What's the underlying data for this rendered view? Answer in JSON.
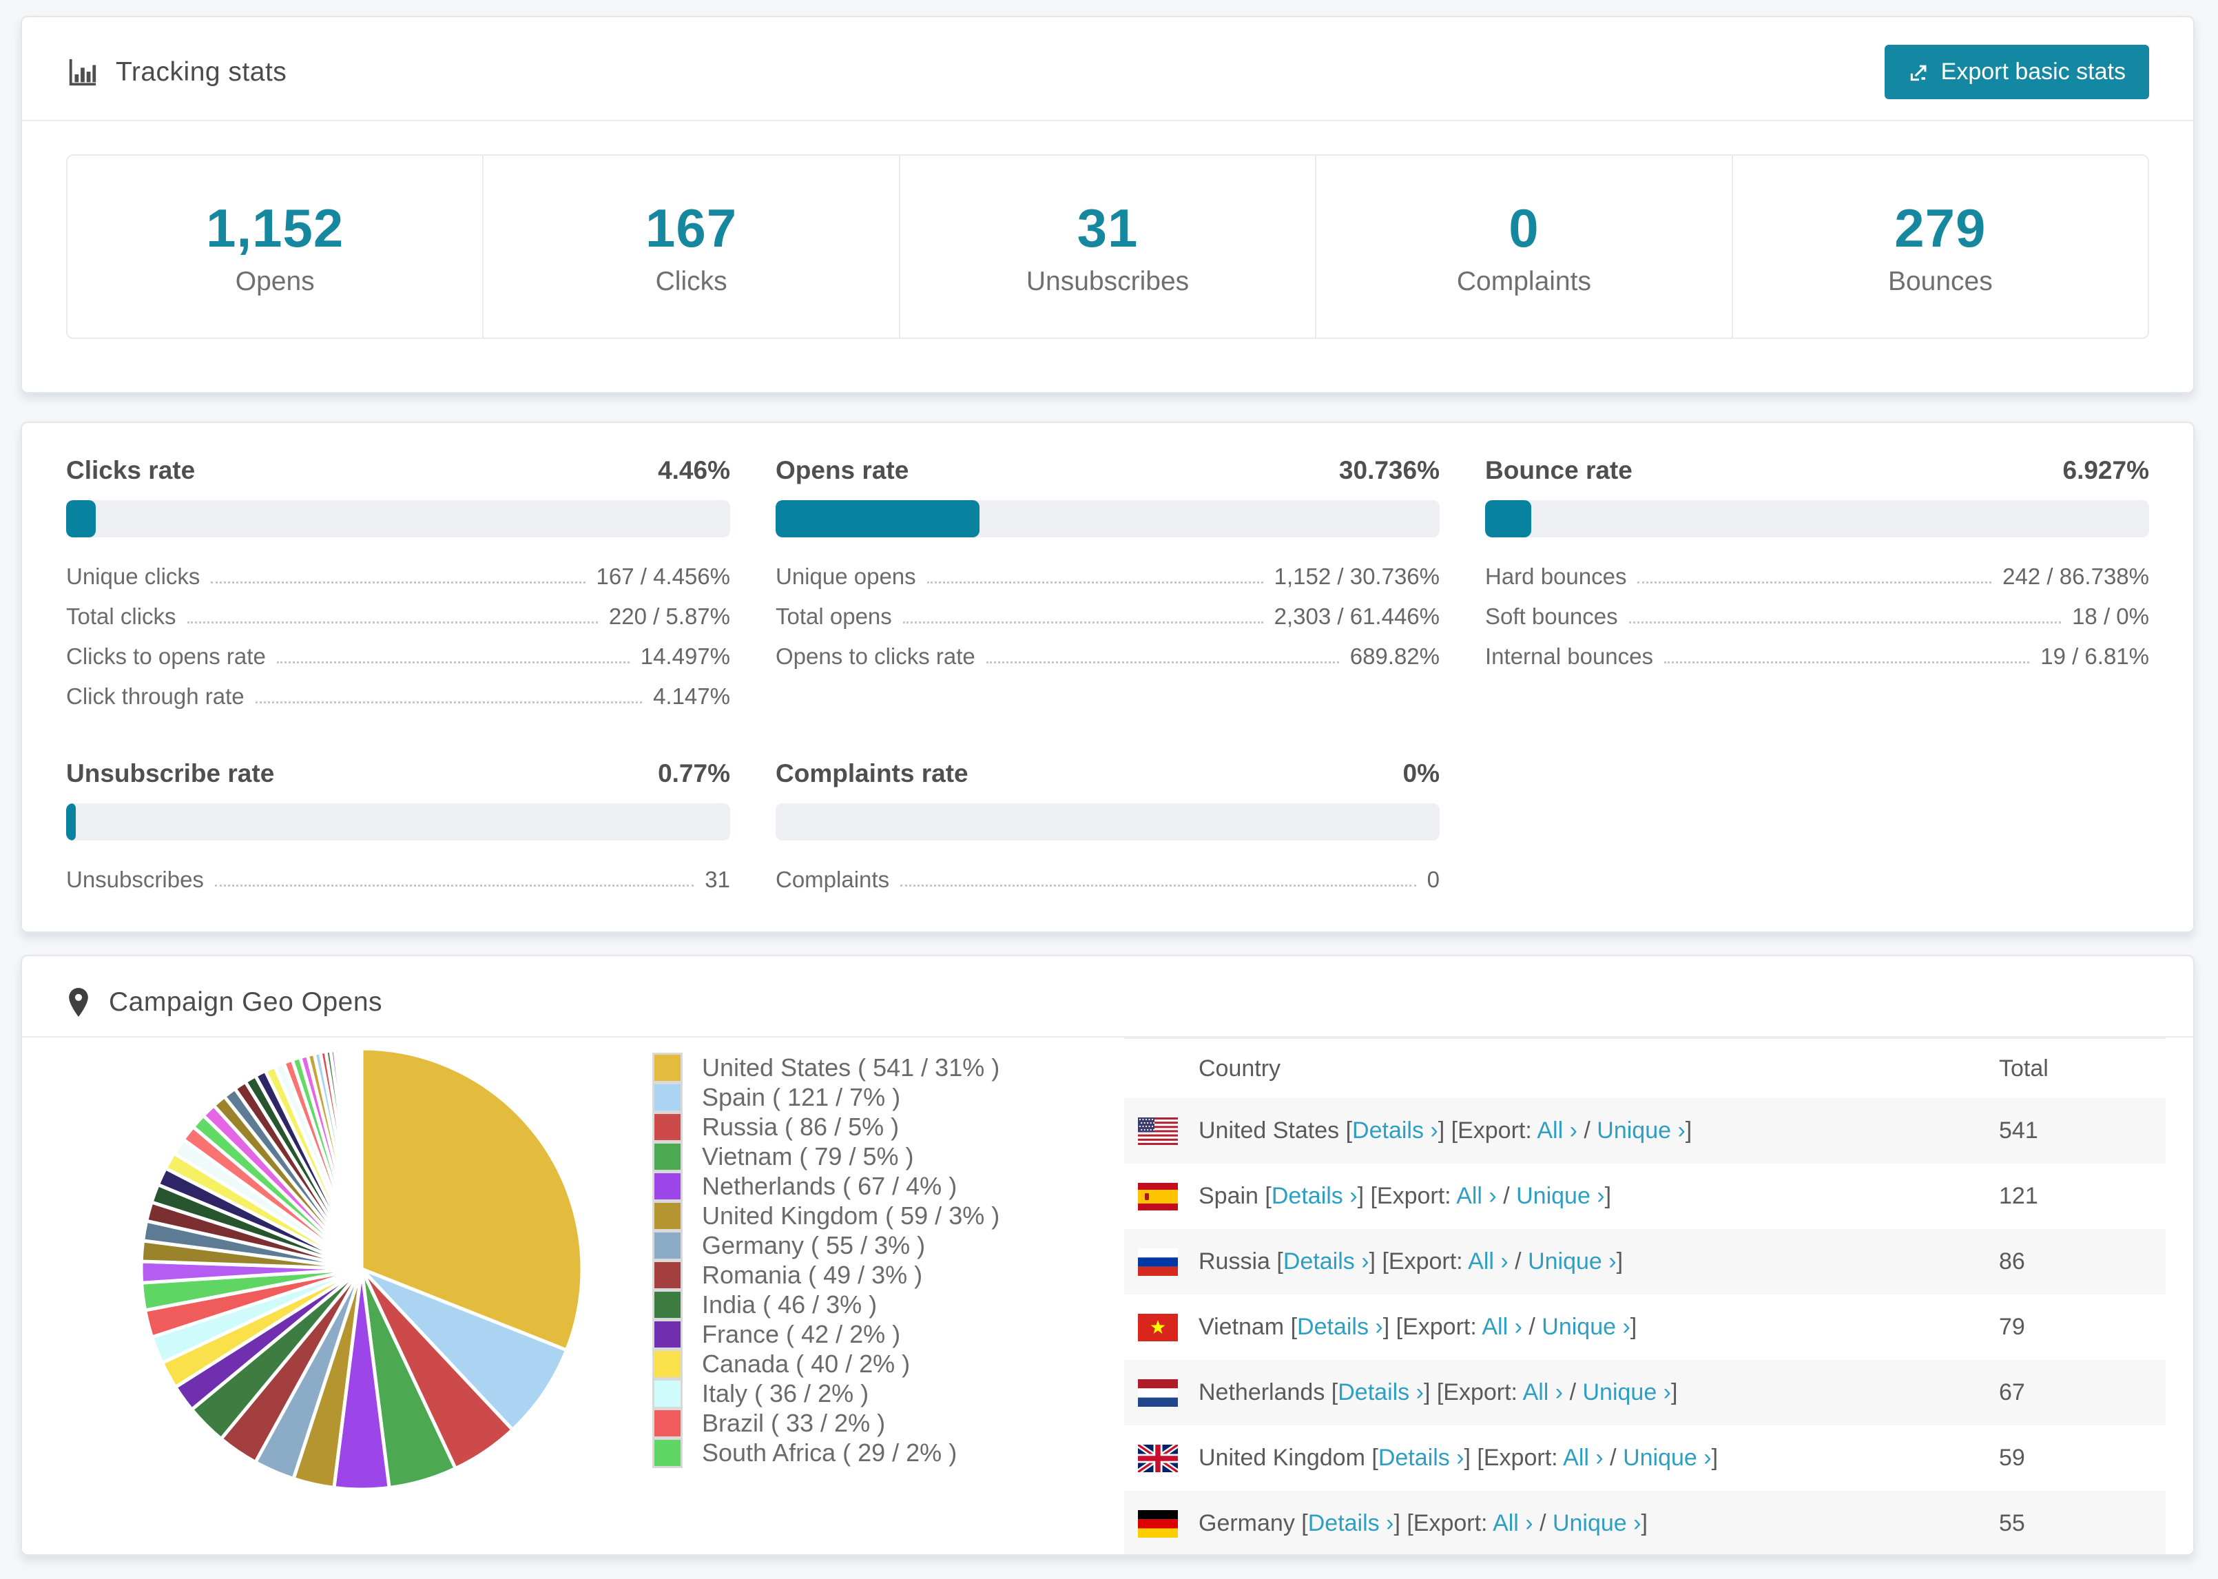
{
  "colors": {
    "accent_teal": "#1488a2",
    "stat_number_teal": "#15879e",
    "bar_fill_teal": "#0982a0",
    "bar_track": "#edeff3",
    "link_teal": "#2d9fc2",
    "page_background": "#f6f7f9"
  },
  "tracking": {
    "title": "Tracking stats",
    "export_button": "Export basic stats",
    "stats": [
      {
        "value": "1,152",
        "label": "Opens"
      },
      {
        "value": "167",
        "label": "Clicks"
      },
      {
        "value": "31",
        "label": "Unsubscribes"
      },
      {
        "value": "0",
        "label": "Complaints"
      },
      {
        "value": "279",
        "label": "Bounces"
      }
    ]
  },
  "rates": [
    {
      "title": "Clicks rate",
      "value": "4.46%",
      "pct": 4.46,
      "rows": [
        {
          "label": "Unique clicks",
          "value": "167 / 4.456%"
        },
        {
          "label": "Total clicks",
          "value": "220 / 5.87%"
        },
        {
          "label": "Clicks to opens rate",
          "value": "14.497%"
        },
        {
          "label": "Click through rate",
          "value": "4.147%"
        }
      ]
    },
    {
      "title": "Opens rate",
      "value": "30.736%",
      "pct": 30.736,
      "rows": [
        {
          "label": "Unique opens",
          "value": "1,152 / 30.736%"
        },
        {
          "label": "Total opens",
          "value": "2,303 / 61.446%"
        },
        {
          "label": "Opens to clicks rate",
          "value": "689.82%"
        }
      ]
    },
    {
      "title": "Bounce rate",
      "value": "6.927%",
      "pct": 6.927,
      "rows": [
        {
          "label": "Hard bounces",
          "value": "242 / 86.738%"
        },
        {
          "label": "Soft bounces",
          "value": "18 / 0%"
        },
        {
          "label": "Internal bounces",
          "value": "19 / 6.81%"
        }
      ]
    },
    {
      "title": "Unsubscribe rate",
      "value": "0.77%",
      "pct": 0.77,
      "rows": [
        {
          "label": "Unsubscribes",
          "value": "31"
        }
      ]
    },
    {
      "title": "Complaints rate",
      "value": "0%",
      "pct": 0,
      "rows": [
        {
          "label": "Complaints",
          "value": "0"
        }
      ]
    }
  ],
  "geo": {
    "title": "Campaign Geo Opens",
    "table": {
      "country_header": "Country",
      "total_header": "Total",
      "details_label": "Details ›",
      "export_label": "Export:",
      "all_label": "All ›",
      "unique_label": "Unique ›",
      "rows": [
        {
          "country": "United States",
          "total": "541",
          "flag": "us"
        },
        {
          "country": "Spain",
          "total": "121",
          "flag": "es"
        },
        {
          "country": "Russia",
          "total": "86",
          "flag": "ru"
        },
        {
          "country": "Vietnam",
          "total": "79",
          "flag": "vn"
        },
        {
          "country": "Netherlands",
          "total": "67",
          "flag": "nl"
        },
        {
          "country": "United Kingdom",
          "total": "59",
          "flag": "gb"
        },
        {
          "country": "Germany",
          "total": "55",
          "flag": "de"
        }
      ]
    }
  },
  "chart_data": {
    "type": "pie",
    "title": "Campaign Geo Opens",
    "legend_position": "right",
    "start_angle_deg": -90,
    "direction": "clockwise",
    "series": [
      {
        "name": "United States",
        "value": 541,
        "pct": 31,
        "color": "#e3bb3d"
      },
      {
        "name": "Spain",
        "value": 121,
        "pct": 7,
        "color": "#aad4f2"
      },
      {
        "name": "Russia",
        "value": 86,
        "pct": 5,
        "color": "#cc4a4a"
      },
      {
        "name": "Vietnam",
        "value": 79,
        "pct": 5,
        "color": "#4da852"
      },
      {
        "name": "Netherlands",
        "value": 67,
        "pct": 4,
        "color": "#9c45e8"
      },
      {
        "name": "United Kingdom",
        "value": 59,
        "pct": 3,
        "color": "#b5952f"
      },
      {
        "name": "Germany",
        "value": 55,
        "pct": 3,
        "color": "#8cabc7"
      },
      {
        "name": "Romania",
        "value": 49,
        "pct": 3,
        "color": "#a33f3f"
      },
      {
        "name": "India",
        "value": 46,
        "pct": 3,
        "color": "#3e7d41"
      },
      {
        "name": "France",
        "value": 42,
        "pct": 2,
        "color": "#6f2fae"
      },
      {
        "name": "Canada",
        "value": 40,
        "pct": 2,
        "color": "#fae14b"
      },
      {
        "name": "Italy",
        "value": 36,
        "pct": 2,
        "color": "#d0fbfb"
      },
      {
        "name": "Brazil",
        "value": 33,
        "pct": 2,
        "color": "#f05c5c"
      },
      {
        "name": "South Africa",
        "value": 29,
        "pct": 2,
        "color": "#5fd664"
      }
    ],
    "others_tail": [
      {
        "pct": 1.55,
        "color": "#b55cf2"
      },
      {
        "pct": 1.5,
        "color": "#9a832a"
      },
      {
        "pct": 1.45,
        "color": "#5d7b95"
      },
      {
        "pct": 1.4,
        "color": "#7c2f30"
      },
      {
        "pct": 1.35,
        "color": "#27552e"
      },
      {
        "pct": 1.3,
        "color": "#2e2566"
      },
      {
        "pct": 1.25,
        "color": "#f5f163"
      },
      {
        "pct": 1.2,
        "color": "#effbfb"
      },
      {
        "pct": 1.15,
        "color": "#f97373"
      },
      {
        "pct": 1.1,
        "color": "#61da66"
      },
      {
        "pct": 1.05,
        "color": "#e466e4"
      },
      {
        "pct": 1.0,
        "color": "#9a832a"
      },
      {
        "pct": 0.95,
        "color": "#5d7b95"
      },
      {
        "pct": 0.9,
        "color": "#7c2f30"
      },
      {
        "pct": 0.85,
        "color": "#27552e"
      },
      {
        "pct": 0.8,
        "color": "#2e2566"
      },
      {
        "pct": 0.75,
        "color": "#f5f163"
      },
      {
        "pct": 0.7,
        "color": "#effbfb"
      },
      {
        "pct": 0.65,
        "color": "#f97373"
      },
      {
        "pct": 0.6,
        "color": "#61da66"
      },
      {
        "pct": 0.55,
        "color": "#e466e4"
      },
      {
        "pct": 0.5,
        "color": "#c7a43b"
      },
      {
        "pct": 0.45,
        "color": "#a9d2f0"
      },
      {
        "pct": 0.4,
        "color": "#d94f4f"
      },
      {
        "pct": 0.35,
        "color": "#3e7d41"
      },
      {
        "pct": 0.3,
        "color": "#8c46d8"
      },
      {
        "pct": 0.26,
        "color": "#b5952f"
      },
      {
        "pct": 0.22,
        "color": "#8cabc7"
      },
      {
        "pct": 0.18,
        "color": "#a33f3f"
      },
      {
        "pct": 0.15,
        "color": "#4da852"
      },
      {
        "pct": 0.12,
        "color": "#6f2fae"
      },
      {
        "pct": 0.1,
        "color": "#fae14b"
      },
      {
        "pct": 0.08,
        "color": "#d0fbfb"
      },
      {
        "pct": 0.07,
        "color": "#f05c5c"
      },
      {
        "pct": 0.06,
        "color": "#5fd664"
      },
      {
        "pct": 0.05,
        "color": "#e3bb3d"
      },
      {
        "pct": 0.04,
        "color": "#aad4f2"
      },
      {
        "pct": 0.04,
        "color": "#cc4a4a"
      },
      {
        "pct": 0.03,
        "color": "#dddddd"
      },
      {
        "pct": 0.03,
        "color": "#eeeeee"
      }
    ]
  }
}
